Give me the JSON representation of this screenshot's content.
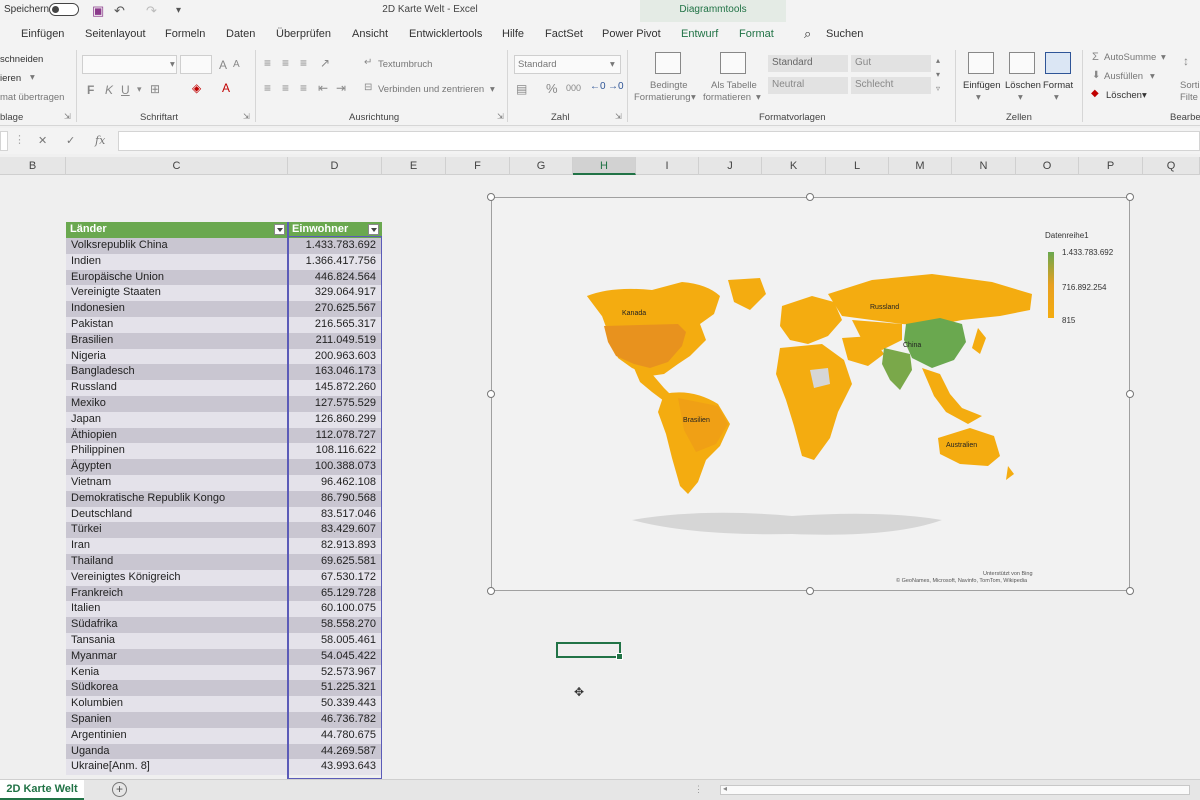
{
  "titlebar": {
    "autosave_label": "Speichern",
    "document_title": "2D Karte Welt  -  Excel",
    "context_tools_label": "Diagrammtools"
  },
  "ribbon_tabs": [
    "Einfügen",
    "Seitenlayout",
    "Formeln",
    "Daten",
    "Überprüfen",
    "Ansicht",
    "Entwicklertools",
    "Hilfe",
    "FactSet",
    "Power Pivot",
    "Entwurf",
    "Format"
  ],
  "search_label": "Suchen",
  "ribbon": {
    "clipboard": {
      "cut": "schneiden",
      "copy": "ieren",
      "format_painter": "mat übertragen",
      "group": "blage"
    },
    "font": {
      "group": "Schriftart",
      "bold": "F",
      "italic": "K",
      "underline": "U"
    },
    "alignment": {
      "wrap_text": "Textumbruch",
      "merge_center": "Verbinden und zentrieren",
      "group": "Ausrichtung"
    },
    "number": {
      "format_value": "Standard",
      "percent": "%",
      "thousands": "000",
      "group": "Zahl"
    },
    "styles": {
      "conditional_1": "Bedingte",
      "conditional_2": "Formatierung",
      "as_table_1": "Als Tabelle",
      "as_table_2": "formatieren",
      "cells": [
        "Standard",
        "Gut",
        "Neutral",
        "Schlecht"
      ],
      "group": "Formatvorlagen"
    },
    "cells": {
      "insert": "Einfügen",
      "delete": "Löschen",
      "format": "Format",
      "group": "Zellen"
    },
    "editing": {
      "autosum": "AutoSumme",
      "fill": "Ausfüllen",
      "clear": "Löschen",
      "sort_1": "Sorti",
      "sort_2": "Filte",
      "group": "Bearbe"
    }
  },
  "formulabar": {
    "fx": "fx",
    "cancel": "✕",
    "enter": "✓"
  },
  "columns": [
    "B",
    "C",
    "D",
    "E",
    "F",
    "G",
    "H",
    "I",
    "J",
    "K",
    "L",
    "M",
    "N",
    "O",
    "P",
    "Q"
  ],
  "table": {
    "header_country": "Länder",
    "header_population": "Einwohner",
    "rows": [
      {
        "country": "Volksrepublik China",
        "population": "1.433.783.692"
      },
      {
        "country": "Indien",
        "population": "1.366.417.756"
      },
      {
        "country": "Europäische Union",
        "population": "446.824.564"
      },
      {
        "country": "Vereinigte Staaten",
        "population": "329.064.917"
      },
      {
        "country": "Indonesien",
        "population": "270.625.567"
      },
      {
        "country": "Pakistan",
        "population": "216.565.317"
      },
      {
        "country": "Brasilien",
        "population": "211.049.519"
      },
      {
        "country": "Nigeria",
        "population": "200.963.603"
      },
      {
        "country": "Bangladesch",
        "population": "163.046.173"
      },
      {
        "country": "Russland",
        "population": "145.872.260"
      },
      {
        "country": "Mexiko",
        "population": "127.575.529"
      },
      {
        "country": "Japan",
        "population": "126.860.299"
      },
      {
        "country": "Äthiopien",
        "population": "112.078.727"
      },
      {
        "country": "Philippinen",
        "population": "108.116.622"
      },
      {
        "country": "Ägypten",
        "population": "100.388.073"
      },
      {
        "country": "Vietnam",
        "population": "96.462.108"
      },
      {
        "country": "Demokratische Republik Kongo",
        "population": "86.790.568"
      },
      {
        "country": "Deutschland",
        "population": "83.517.046"
      },
      {
        "country": "Türkei",
        "population": "83.429.607"
      },
      {
        "country": "Iran",
        "population": "82.913.893"
      },
      {
        "country": "Thailand",
        "population": "69.625.581"
      },
      {
        "country": "Vereinigtes Königreich",
        "population": "67.530.172"
      },
      {
        "country": "Frankreich",
        "population": "65.129.728"
      },
      {
        "country": "Italien",
        "population": "60.100.075"
      },
      {
        "country": "Südafrika",
        "population": "58.558.270"
      },
      {
        "country": "Tansania",
        "population": "58.005.461"
      },
      {
        "country": "Myanmar",
        "population": "54.045.422"
      },
      {
        "country": "Kenia",
        "population": "52.573.967"
      },
      {
        "country": "Südkorea",
        "population": "51.225.321"
      },
      {
        "country": "Kolumbien",
        "population": "50.339.443"
      },
      {
        "country": "Spanien",
        "population": "46.736.782"
      },
      {
        "country": "Argentinien",
        "population": "44.780.675"
      },
      {
        "country": "Uganda",
        "population": "44.269.587"
      },
      {
        "country": "Ukraine[Anm. 8]",
        "population": "43.993.643"
      }
    ]
  },
  "map_chart": {
    "legend_title": "Datenreihe1",
    "legend_max": "1.433.783.692",
    "legend_mid": "716.892.254",
    "legend_min": "815",
    "labels": [
      "Kanada",
      "Russland",
      "China",
      "Brasilien",
      "Australien"
    ],
    "credit_1": "Unterstützt von Bing",
    "credit_2": "© GeoNames, Microsoft, Navinfo, TomTom, Wikipedia",
    "color_high": "#6aa84f",
    "color_mid": "#e8921e",
    "color_low": "#f4ac10"
  },
  "sheet_tab": "2D Karte Welt",
  "add_sheet": "+",
  "accent_color": "#217346"
}
